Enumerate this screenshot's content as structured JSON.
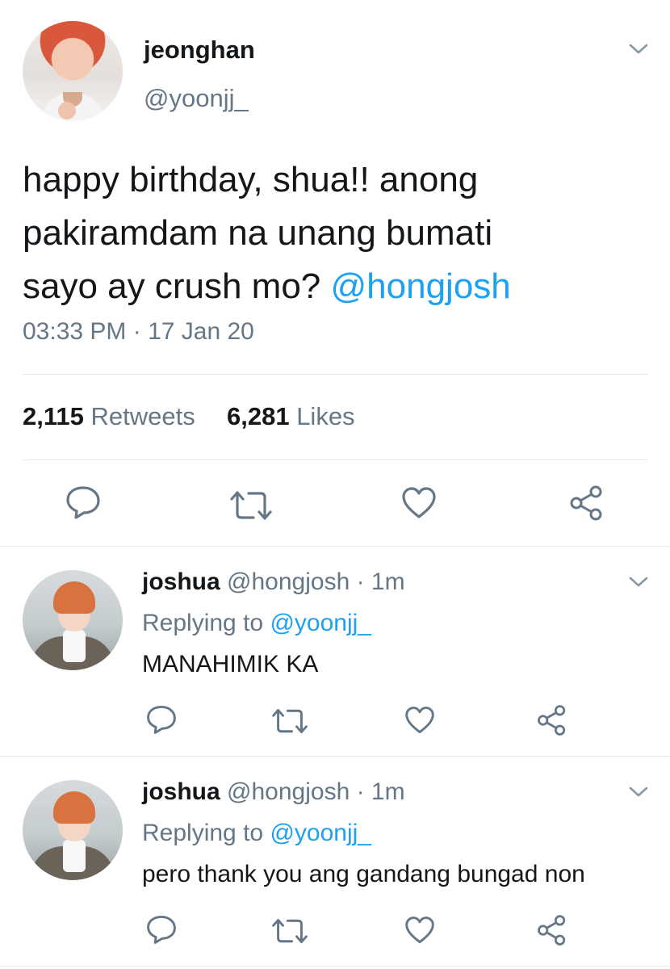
{
  "main_tweet": {
    "display_name": "jeonghan",
    "handle": "@yoonjj_",
    "text_lines": [
      "happy birthday, shua!! anong",
      "pakiramdam na unang bumati",
      "sayo ay crush mo? "
    ],
    "mention": "@hongjosh",
    "timestamp": "03:33 PM · 17 Jan 20",
    "retweets_count": "2,115",
    "retweets_label": "Retweets",
    "likes_count": "6,281",
    "likes_label": "Likes"
  },
  "replies": [
    {
      "display_name": "joshua",
      "handle": "@hongjosh",
      "time": "· 1m",
      "replying_label": "Replying to",
      "replying_to": "@yoonjj_",
      "text": "MANAHIMIK KA"
    },
    {
      "display_name": "joshua",
      "handle": "@hongjosh",
      "time": "· 1m",
      "replying_label": "Replying to",
      "replying_to": "@yoonjj_",
      "text": "pero thank you ang gandang bungad non"
    }
  ],
  "colors": {
    "link": "#1da1f2",
    "muted": "#657786",
    "divider": "#e1e8ed",
    "icon": "#657786"
  },
  "icons": [
    "chevron-down-icon",
    "reply-icon",
    "retweet-icon",
    "like-icon",
    "share-icon"
  ]
}
